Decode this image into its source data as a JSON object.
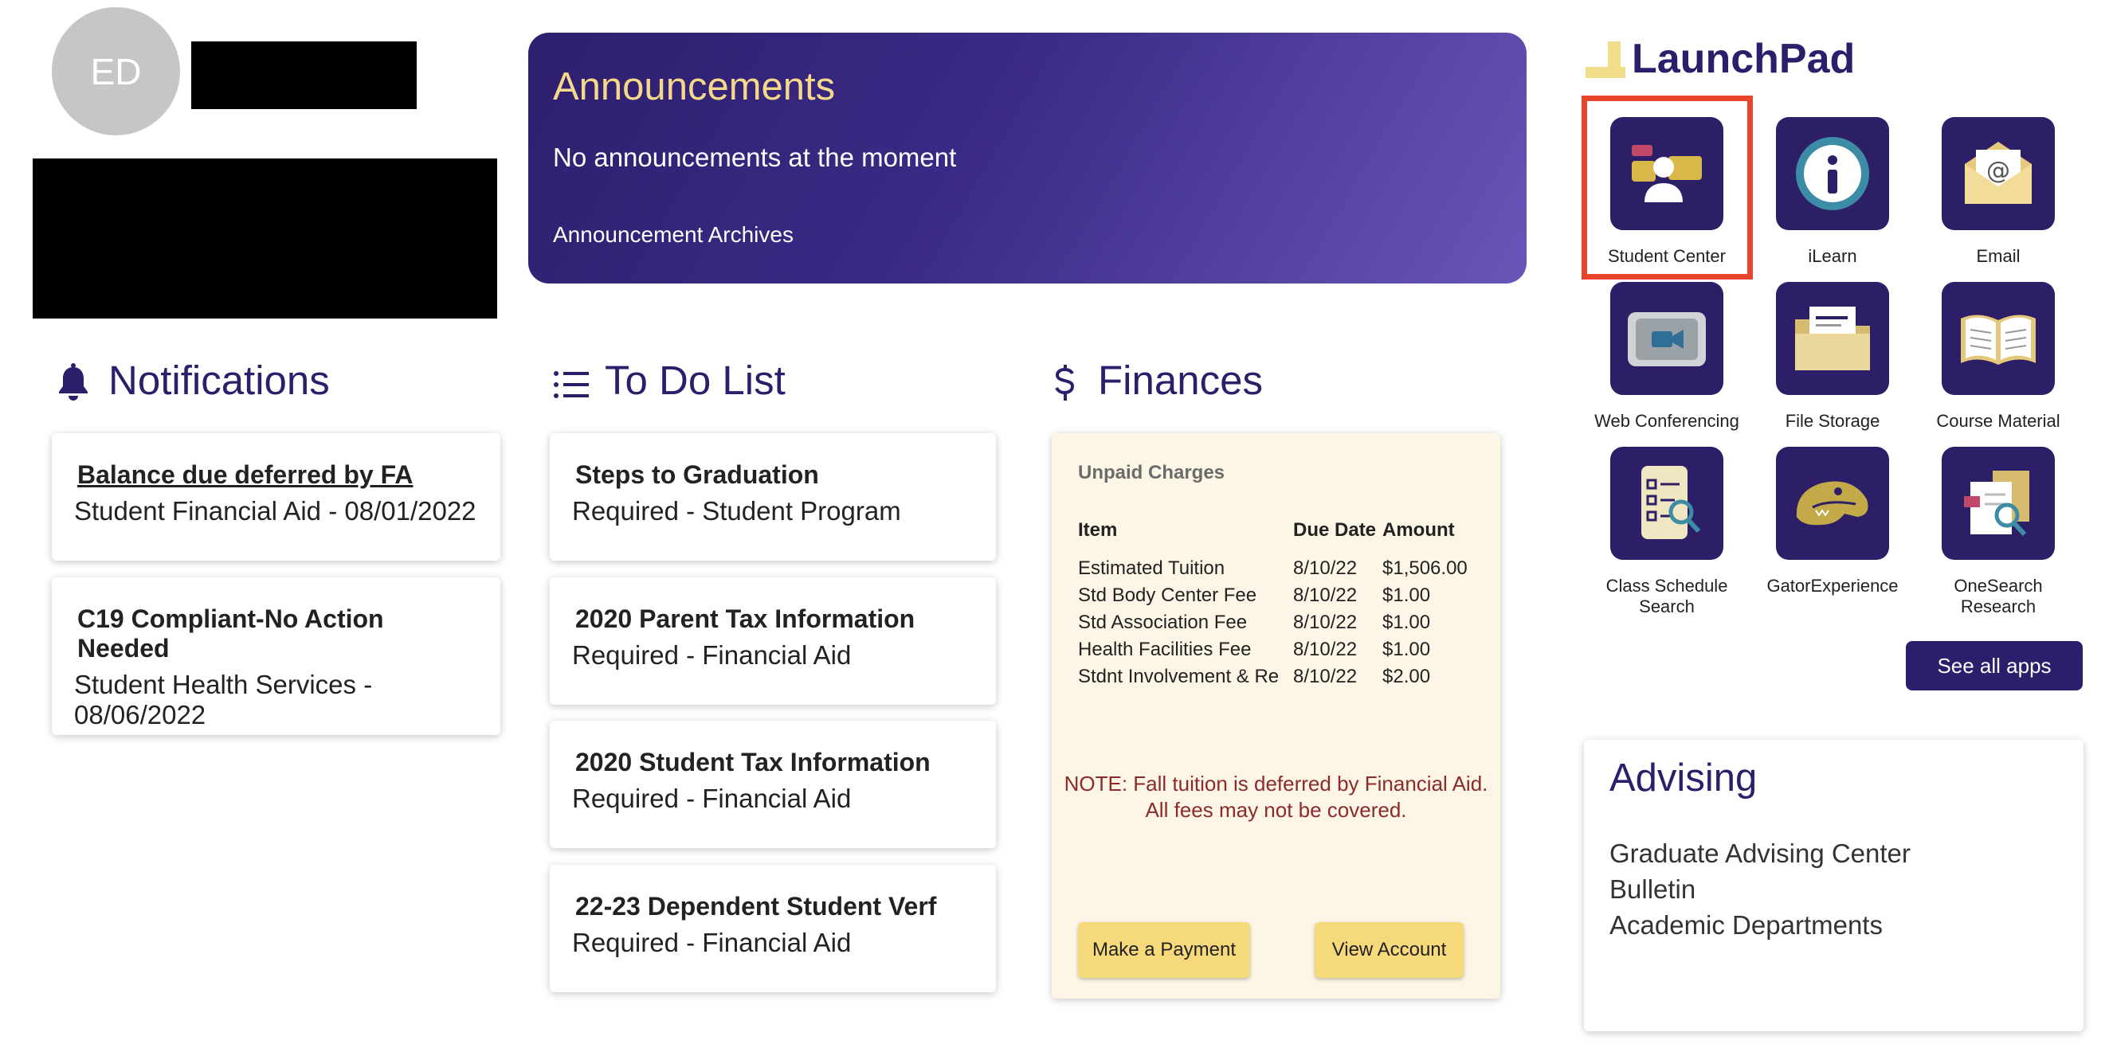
{
  "profile": {
    "initials": "ED"
  },
  "announcements": {
    "title": "Announcements",
    "message": "No announcements at the moment",
    "archives_link": "Announcement Archives"
  },
  "notifications": {
    "title": "Notifications",
    "icon": "bell-icon",
    "items": [
      {
        "title": "Balance due deferred by FA",
        "subtitle": "Student Financial Aid - 08/01/2022"
      },
      {
        "title": "C19 Compliant-No Action Needed",
        "subtitle": "Student Health Services - 08/06/2022"
      }
    ]
  },
  "todo": {
    "title": "To Do List",
    "icon": "list-icon",
    "items": [
      {
        "title": "Steps to Graduation",
        "subtitle": "Required - Student Program"
      },
      {
        "title": "2020 Parent Tax Information",
        "subtitle": "Required - Financial Aid"
      },
      {
        "title": "2020 Student Tax Information",
        "subtitle": "Required - Financial Aid"
      },
      {
        "title": "22-23 Dependent Student Verf",
        "subtitle": "Required - Financial Aid"
      }
    ]
  },
  "finances": {
    "title": "Finances",
    "icon": "dollar-icon",
    "section_title": "Unpaid Charges",
    "columns": [
      "Item",
      "Due Date",
      "Amount"
    ],
    "rows": [
      [
        "Estimated Tuition",
        "8/10/22",
        "$1,506.00"
      ],
      [
        "Std Body Center Fee",
        "8/10/22",
        "$1.00"
      ],
      [
        "Std Association Fee",
        "8/10/22",
        "$1.00"
      ],
      [
        "Health Facilities Fee",
        "8/10/22",
        "$1.00"
      ],
      [
        "Stdnt Involvement & Re",
        "8/10/22",
        "$2.00"
      ]
    ],
    "note_line1": "NOTE: Fall tuition is deferred by Financial Aid.",
    "note_line2": "All fees may not be covered.",
    "pay_button": "Make a Payment",
    "view_button": "View Account"
  },
  "launchpad": {
    "title": "LaunchPad",
    "apps": [
      {
        "label": "Student Center",
        "icon": "student-center-icon"
      },
      {
        "label": "iLearn",
        "icon": "info-icon"
      },
      {
        "label": "Email",
        "icon": "email-icon"
      },
      {
        "label": "Web Conferencing",
        "icon": "video-camera-icon"
      },
      {
        "label": "File Storage",
        "icon": "folder-icon"
      },
      {
        "label": "Course Material",
        "icon": "open-book-icon"
      },
      {
        "label": "Class Schedule Search",
        "icon": "schedule-search-icon"
      },
      {
        "label": "GatorExperience",
        "icon": "gator-icon"
      },
      {
        "label": "OneSearch Research",
        "icon": "research-icon"
      }
    ],
    "see_all": "See all apps"
  },
  "advising": {
    "title": "Advising",
    "links": [
      "Graduate Advising Center",
      "Bulletin",
      "Academic Departments"
    ]
  },
  "colors": {
    "brand_purple": "#2a1f6b",
    "announce_gold": "#f5d98a",
    "button_gold": "#f6d97a",
    "highlight_red": "#e8432b",
    "note_red": "#8b2a2a",
    "finance_bg": "#fdf6e6"
  }
}
